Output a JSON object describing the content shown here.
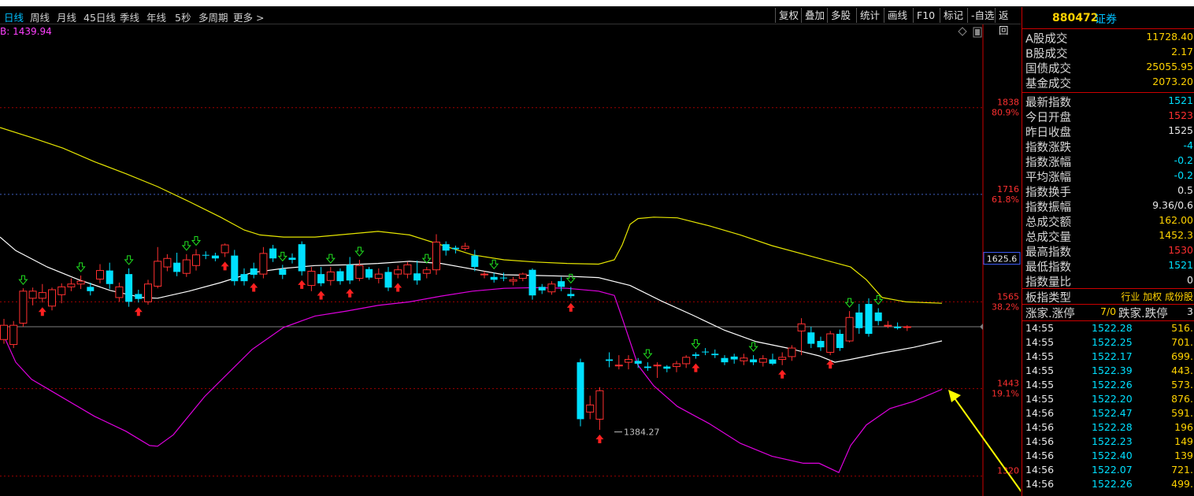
{
  "period_tabs": [
    "日线",
    "周线",
    "月线",
    "45日线",
    "季线",
    "年线",
    "5秒",
    "多周期",
    "更多 >"
  ],
  "toolbar_buttons": [
    "复权",
    "叠加",
    "多股",
    "统计",
    "画线",
    "F10",
    "标记",
    "-自选",
    "返回"
  ],
  "ma_label": "B: 1439.94",
  "colors": {
    "up": "#ff3030",
    "down": "#00e0ff",
    "upper_band": "#e6e600",
    "mid_band": "#ffffff",
    "lower_band": "#e000e0",
    "annotation": "#ffff00"
  },
  "right_panel": {
    "code": "880472",
    "name": "证券",
    "trade_rows": [
      {
        "label": "A股成交",
        "value": "11728.40"
      },
      {
        "label": "B股成交",
        "value": "2.17"
      },
      {
        "label": "国债成交",
        "value": "25055.95"
      },
      {
        "label": "基金成交",
        "value": "2073.20"
      }
    ],
    "index_rows": [
      {
        "label": "最新指数",
        "value": "1521",
        "color": "#00e0ff"
      },
      {
        "label": "今日开盘",
        "value": "1523",
        "color": "#ff3030"
      },
      {
        "label": "昨日收盘",
        "value": "1525",
        "color": "#e8e8e8"
      },
      {
        "label": "指数涨跌",
        "value": "-4",
        "color": "#00e0ff"
      },
      {
        "label": "指数涨幅",
        "value": "-0.2",
        "color": "#00e0ff"
      },
      {
        "label": "平均涨幅",
        "value": "-0.2",
        "color": "#00e0ff"
      },
      {
        "label": "指数换手",
        "value": "0.5",
        "color": "#e8e8e8"
      },
      {
        "label": "指数振幅",
        "value": "9.36/0.6",
        "color": "#e8e8e8"
      },
      {
        "label": "总成交额",
        "value": "162.00",
        "color": "#ffd200"
      },
      {
        "label": "总成交量",
        "value": "1452.3",
        "color": "#ffd200"
      },
      {
        "label": "最高指数",
        "value": "1530",
        "color": "#ff3030"
      },
      {
        "label": "最低指数",
        "value": "1521",
        "color": "#00e0ff"
      },
      {
        "label": "指数量比",
        "value": "0",
        "color": "#e8e8e8"
      }
    ],
    "category_row": {
      "label": "板指类型",
      "value": "行业 加权 成份股"
    },
    "updown_row": {
      "label": "涨家.涨停",
      "mid": "7/0",
      "label2": "跌家.跌停",
      "value": "3"
    },
    "ticks": [
      {
        "time": "14:55",
        "price": "1522.28",
        "vol": "516."
      },
      {
        "time": "14:55",
        "price": "1522.25",
        "vol": "701."
      },
      {
        "time": "14:55",
        "price": "1522.17",
        "vol": "699."
      },
      {
        "time": "14:55",
        "price": "1522.39",
        "vol": "443."
      },
      {
        "time": "14:55",
        "price": "1522.26",
        "vol": "573."
      },
      {
        "time": "14:55",
        "price": "1522.20",
        "vol": "876."
      },
      {
        "time": "14:56",
        "price": "1522.47",
        "vol": "591."
      },
      {
        "time": "14:56",
        "price": "1522.28",
        "vol": "196"
      },
      {
        "time": "14:56",
        "price": "1522.23",
        "vol": "149"
      },
      {
        "time": "14:56",
        "price": "1522.40",
        "vol": "139"
      },
      {
        "time": "14:56",
        "price": "1522.07",
        "vol": "721."
      },
      {
        "time": "14:56",
        "price": "1522.26",
        "vol": "499."
      }
    ]
  },
  "chart_data": {
    "type": "candlestick",
    "ylim": [
      1292,
      1955
    ],
    "price_levels": [
      {
        "price": 1838,
        "label": "1838",
        "pct": "80.9%"
      },
      {
        "price": 1716,
        "label": "1716",
        "pct": "61.8%"
      },
      {
        "price": 1565,
        "label": "1565",
        "pct": "38.2%"
      },
      {
        "price": 1443,
        "label": "1443",
        "pct": "19.1%"
      },
      {
        "price": 1320,
        "label": "1320",
        "pct": ""
      }
    ],
    "current_price": "1625.6",
    "current_price_value": 1625.6,
    "min_label": "1384.27",
    "min_value": 1384.27,
    "last_close": 1530,
    "candles": [
      [
        1512,
        1532,
        1506,
        1541
      ],
      [
        1505,
        1532,
        1500,
        1538
      ],
      [
        1535,
        1580,
        1530,
        1584
      ],
      [
        1570,
        1580,
        1560,
        1585
      ],
      [
        1570,
        1578,
        1564,
        1590
      ],
      [
        1559,
        1582,
        1553,
        1585
      ],
      [
        1575,
        1586,
        1563,
        1591
      ],
      [
        1586,
        1590,
        1580,
        1598
      ],
      [
        1590,
        1594,
        1583,
        1602
      ],
      [
        1586,
        1580,
        1574,
        1592
      ],
      [
        1597,
        1609,
        1591,
        1618
      ],
      [
        1609,
        1590,
        1583,
        1620
      ],
      [
        1571,
        1586,
        1565,
        1592
      ],
      [
        1604,
        1565,
        1558,
        1612
      ],
      [
        1576,
        1569,
        1564,
        1582
      ],
      [
        1565,
        1590,
        1561,
        1596
      ],
      [
        1587,
        1622,
        1584,
        1642
      ],
      [
        1614,
        1626,
        1608,
        1632
      ],
      [
        1620,
        1607,
        1601,
        1634
      ],
      [
        1605,
        1624,
        1600,
        1632
      ],
      [
        1616,
        1631,
        1609,
        1639
      ],
      [
        1631,
        1630,
        1625,
        1636
      ],
      [
        1630,
        1626,
        1622,
        1634
      ],
      [
        1634,
        1645,
        1628,
        1647
      ],
      [
        1630,
        1594,
        1588,
        1638
      ],
      [
        1604,
        1594,
        1588,
        1612
      ],
      [
        1612,
        1603,
        1598,
        1620
      ],
      [
        1604,
        1633,
        1598,
        1642
      ],
      [
        1640,
        1626,
        1621,
        1645
      ],
      [
        1611,
        1603,
        1597,
        1617
      ],
      [
        1627,
        1624,
        1619,
        1633
      ],
      [
        1646,
        1608,
        1602,
        1650
      ],
      [
        1588,
        1608,
        1580,
        1614
      ],
      [
        1604,
        1591,
        1587,
        1614
      ],
      [
        1595,
        1607,
        1588,
        1614
      ],
      [
        1608,
        1594,
        1589,
        1612
      ],
      [
        1617,
        1595,
        1590,
        1628
      ],
      [
        1598,
        1616,
        1594,
        1624
      ],
      [
        1611,
        1599,
        1596,
        1614
      ],
      [
        1598,
        1604,
        1591,
        1612
      ],
      [
        1607,
        1585,
        1580,
        1614
      ],
      [
        1604,
        1610,
        1598,
        1616
      ],
      [
        1604,
        1617,
        1598,
        1621
      ],
      [
        1605,
        1595,
        1589,
        1623
      ],
      [
        1605,
        1610,
        1598,
        1614
      ],
      [
        1610,
        1649,
        1603,
        1660
      ],
      [
        1646,
        1637,
        1630,
        1650
      ],
      [
        1641,
        1639,
        1633,
        1644
      ],
      [
        1640,
        1643,
        1637,
        1648
      ],
      [
        1630,
        1614,
        1608,
        1638
      ],
      [
        1604,
        1604,
        1598,
        1608
      ],
      [
        1600,
        1596,
        1592,
        1606
      ],
      [
        1599,
        1598,
        1594,
        1606
      ],
      [
        1594,
        1596,
        1588,
        1600
      ],
      [
        1598,
        1604,
        1594,
        1606
      ],
      [
        1610,
        1574,
        1568,
        1612
      ],
      [
        1586,
        1581,
        1576,
        1590
      ],
      [
        1579,
        1590,
        1575,
        1594
      ],
      [
        1594,
        1586,
        1580,
        1600
      ],
      [
        1576,
        1573,
        1570,
        1586
      ],
      [
        1480,
        1400,
        1390,
        1485
      ],
      [
        1410,
        1420,
        1400,
        1433
      ],
      [
        1400,
        1440,
        1385,
        1445
      ],
      [
        1484,
        1482,
        1473,
        1494
      ],
      [
        1476,
        1476,
        1470,
        1490
      ],
      [
        1480,
        1484,
        1470,
        1490
      ],
      [
        1482,
        1478,
        1472,
        1486
      ],
      [
        1474,
        1472,
        1468,
        1480
      ],
      [
        1476,
        1476,
        1458,
        1480
      ],
      [
        1474,
        1471,
        1466,
        1476
      ],
      [
        1474,
        1478,
        1466,
        1482
      ],
      [
        1478,
        1487,
        1472,
        1490
      ],
      [
        1491,
        1489,
        1485,
        1494
      ],
      [
        1495,
        1494,
        1490,
        1500
      ],
      [
        1492,
        1490,
        1486,
        1498
      ],
      [
        1486,
        1480,
        1476,
        1490
      ],
      [
        1488,
        1484,
        1478,
        1492
      ],
      [
        1482,
        1486,
        1476,
        1492
      ],
      [
        1484,
        1480,
        1476,
        1490
      ],
      [
        1480,
        1485,
        1474,
        1490
      ],
      [
        1484,
        1478,
        1476,
        1492
      ],
      [
        1484,
        1487,
        1476,
        1494
      ],
      [
        1488,
        1500,
        1482,
        1504
      ],
      [
        1524,
        1534,
        1490,
        1542
      ],
      [
        1522,
        1506,
        1500,
        1530
      ],
      [
        1510,
        1501,
        1496,
        1516
      ],
      [
        1494,
        1520,
        1490,
        1524
      ],
      [
        1520,
        1500,
        1496,
        1526
      ],
      [
        1510,
        1543,
        1508,
        1552
      ],
      [
        1550,
        1528,
        1520,
        1562
      ],
      [
        1562,
        1520,
        1516,
        1570
      ],
      [
        1550,
        1538,
        1532,
        1556
      ],
      [
        1532,
        1532,
        1528,
        1538
      ],
      [
        1530,
        1528,
        1526,
        1536
      ],
      [
        1530,
        1530,
        1524,
        1532
      ]
    ],
    "bands": {
      "upper": [
        [
          0,
          1810
        ],
        [
          40,
          1796
        ],
        [
          80,
          1781
        ],
        [
          120,
          1762
        ],
        [
          160,
          1745
        ],
        [
          200,
          1727
        ],
        [
          240,
          1706
        ],
        [
          280,
          1684
        ],
        [
          310,
          1666
        ],
        [
          330,
          1659
        ],
        [
          360,
          1656
        ],
        [
          400,
          1656
        ],
        [
          440,
          1660
        ],
        [
          480,
          1664
        ],
        [
          520,
          1659
        ],
        [
          560,
          1645
        ],
        [
          600,
          1631
        ],
        [
          640,
          1624
        ],
        [
          680,
          1621
        ],
        [
          720,
          1619
        ],
        [
          760,
          1618
        ],
        [
          780,
          1624
        ],
        [
          790,
          1645
        ],
        [
          800,
          1674
        ],
        [
          810,
          1682
        ],
        [
          830,
          1684
        ],
        [
          860,
          1683
        ],
        [
          900,
          1672
        ],
        [
          940,
          1659
        ],
        [
          980,
          1644
        ],
        [
          1020,
          1632
        ],
        [
          1060,
          1620
        ],
        [
          1080,
          1614
        ],
        [
          1100,
          1596
        ],
        [
          1120,
          1571
        ],
        [
          1150,
          1565
        ],
        [
          1196,
          1563
        ]
      ],
      "mid": [
        [
          0,
          1656
        ],
        [
          20,
          1637
        ],
        [
          60,
          1614
        ],
        [
          100,
          1596
        ],
        [
          140,
          1581
        ],
        [
          180,
          1571
        ],
        [
          200,
          1570
        ],
        [
          240,
          1580
        ],
        [
          280,
          1592
        ],
        [
          320,
          1606
        ],
        [
          360,
          1612
        ],
        [
          400,
          1616
        ],
        [
          440,
          1617
        ],
        [
          480,
          1619
        ],
        [
          520,
          1622
        ],
        [
          560,
          1619
        ],
        [
          600,
          1611
        ],
        [
          640,
          1603
        ],
        [
          680,
          1602
        ],
        [
          720,
          1601
        ],
        [
          760,
          1599
        ],
        [
          800,
          1588
        ],
        [
          840,
          1566
        ],
        [
          880,
          1546
        ],
        [
          920,
          1525
        ],
        [
          960,
          1509
        ],
        [
          1000,
          1500
        ],
        [
          1040,
          1489
        ],
        [
          1060,
          1480
        ],
        [
          1080,
          1484
        ],
        [
          1120,
          1493
        ],
        [
          1160,
          1501
        ],
        [
          1196,
          1510
        ]
      ],
      "lower": [
        [
          0,
          1529
        ],
        [
          20,
          1480
        ],
        [
          40,
          1456
        ],
        [
          80,
          1430
        ],
        [
          120,
          1404
        ],
        [
          160,
          1383
        ],
        [
          190,
          1363
        ],
        [
          200,
          1362
        ],
        [
          220,
          1378
        ],
        [
          260,
          1432
        ],
        [
          320,
          1498
        ],
        [
          360,
          1529
        ],
        [
          400,
          1545
        ],
        [
          440,
          1552
        ],
        [
          480,
          1560
        ],
        [
          520,
          1565
        ],
        [
          560,
          1573
        ],
        [
          600,
          1580
        ],
        [
          640,
          1584
        ],
        [
          680,
          1585
        ],
        [
          720,
          1584
        ],
        [
          760,
          1580
        ],
        [
          780,
          1574
        ],
        [
          790,
          1542
        ],
        [
          810,
          1476
        ],
        [
          830,
          1447
        ],
        [
          860,
          1418
        ],
        [
          900,
          1394
        ],
        [
          940,
          1366
        ],
        [
          980,
          1348
        ],
        [
          1020,
          1338
        ],
        [
          1040,
          1338
        ],
        [
          1065,
          1325
        ],
        [
          1080,
          1363
        ],
        [
          1100,
          1392
        ],
        [
          1130,
          1415
        ],
        [
          1160,
          1425
        ],
        [
          1196,
          1442
        ]
      ]
    },
    "up_arrows": [
      4,
      14,
      23,
      26,
      31,
      33,
      36,
      41,
      59,
      62,
      72,
      81,
      86
    ],
    "down_arrows": [
      2,
      8,
      13,
      19,
      20,
      29,
      34,
      37,
      44,
      51,
      59,
      67,
      72,
      78,
      88,
      91
    ]
  }
}
